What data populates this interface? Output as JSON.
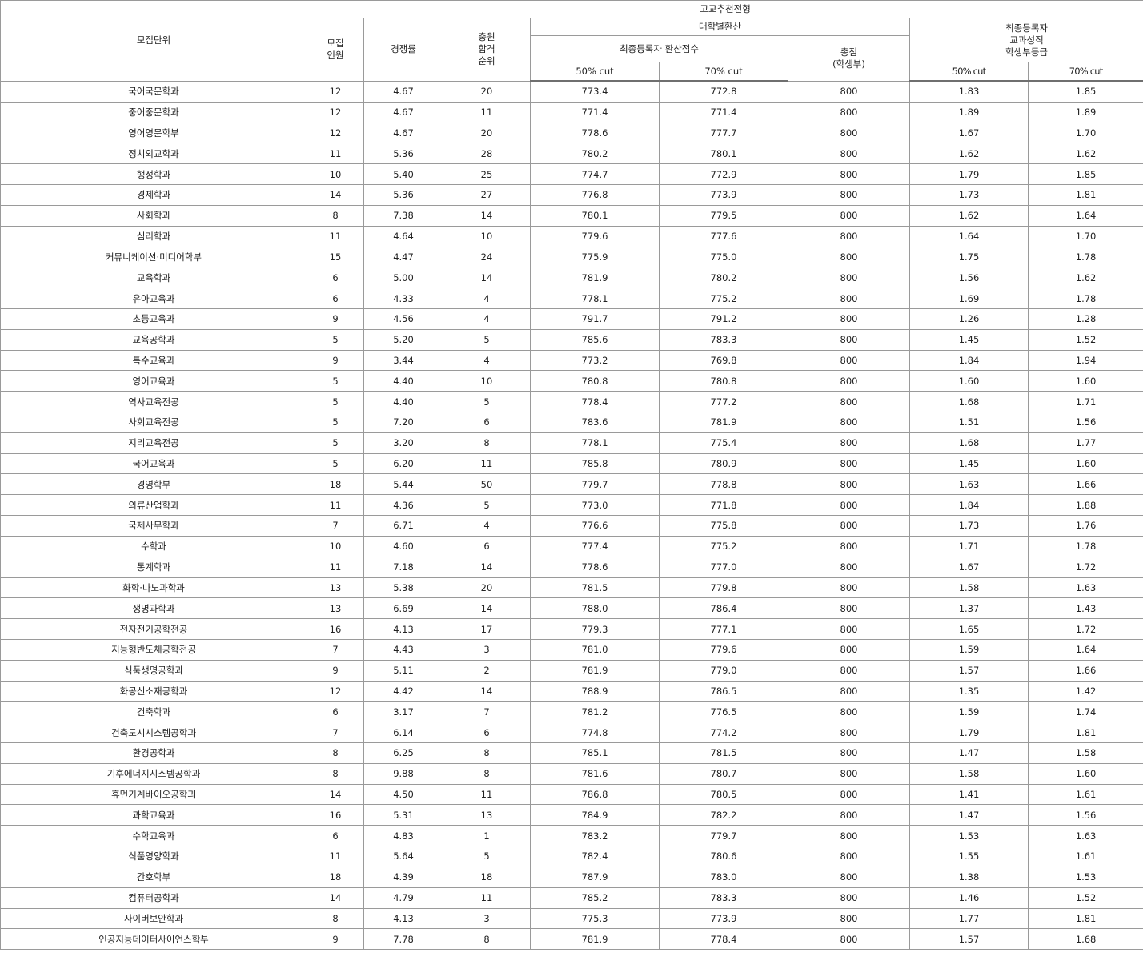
{
  "header": {
    "unit": "모집단위",
    "track": "고교추천전형",
    "quota": [
      "모집",
      "인원"
    ],
    "competition": "경쟁률",
    "waitlist": [
      "충원",
      "합격",
      "순위"
    ],
    "univ_conversion": "대학별환산",
    "final_converted": "최종등록자 환산점수",
    "cut50": "50% cut",
    "cut70": "70% cut",
    "total": [
      "총점",
      "(학생부)"
    ],
    "final_grade": [
      "최종등록자",
      "교과성적",
      "학생부등급"
    ],
    "grade50": "50% cut",
    "grade70": "70% cut"
  },
  "rows": [
    {
      "unit": "국어국문학과",
      "quota": "12",
      "rate": "4.67",
      "wait": "20",
      "s50": "773.4",
      "s70": "772.8",
      "total": "800",
      "g50": "1.83",
      "g70": "1.85"
    },
    {
      "unit": "중어중문학과",
      "quota": "12",
      "rate": "4.67",
      "wait": "11",
      "s50": "771.4",
      "s70": "771.4",
      "total": "800",
      "g50": "1.89",
      "g70": "1.89"
    },
    {
      "unit": "영어영문학부",
      "quota": "12",
      "rate": "4.67",
      "wait": "20",
      "s50": "778.6",
      "s70": "777.7",
      "total": "800",
      "g50": "1.67",
      "g70": "1.70"
    },
    {
      "unit": "정치외교학과",
      "quota": "11",
      "rate": "5.36",
      "wait": "28",
      "s50": "780.2",
      "s70": "780.1",
      "total": "800",
      "g50": "1.62",
      "g70": "1.62"
    },
    {
      "unit": "행정학과",
      "quota": "10",
      "rate": "5.40",
      "wait": "25",
      "s50": "774.7",
      "s70": "772.9",
      "total": "800",
      "g50": "1.79",
      "g70": "1.85"
    },
    {
      "unit": "경제학과",
      "quota": "14",
      "rate": "5.36",
      "wait": "27",
      "s50": "776.8",
      "s70": "773.9",
      "total": "800",
      "g50": "1.73",
      "g70": "1.81"
    },
    {
      "unit": "사회학과",
      "quota": "8",
      "rate": "7.38",
      "wait": "14",
      "s50": "780.1",
      "s70": "779.5",
      "total": "800",
      "g50": "1.62",
      "g70": "1.64"
    },
    {
      "unit": "심리학과",
      "quota": "11",
      "rate": "4.64",
      "wait": "10",
      "s50": "779.6",
      "s70": "777.6",
      "total": "800",
      "g50": "1.64",
      "g70": "1.70"
    },
    {
      "unit": "커뮤니케이션·미디어학부",
      "quota": "15",
      "rate": "4.47",
      "wait": "24",
      "s50": "775.9",
      "s70": "775.0",
      "total": "800",
      "g50": "1.75",
      "g70": "1.78"
    },
    {
      "unit": "교육학과",
      "quota": "6",
      "rate": "5.00",
      "wait": "14",
      "s50": "781.9",
      "s70": "780.2",
      "total": "800",
      "g50": "1.56",
      "g70": "1.62"
    },
    {
      "unit": "유아교육과",
      "quota": "6",
      "rate": "4.33",
      "wait": "4",
      "s50": "778.1",
      "s70": "775.2",
      "total": "800",
      "g50": "1.69",
      "g70": "1.78"
    },
    {
      "unit": "초등교육과",
      "quota": "9",
      "rate": "4.56",
      "wait": "4",
      "s50": "791.7",
      "s70": "791.2",
      "total": "800",
      "g50": "1.26",
      "g70": "1.28"
    },
    {
      "unit": "교육공학과",
      "quota": "5",
      "rate": "5.20",
      "wait": "5",
      "s50": "785.6",
      "s70": "783.3",
      "total": "800",
      "g50": "1.45",
      "g70": "1.52"
    },
    {
      "unit": "특수교육과",
      "quota": "9",
      "rate": "3.44",
      "wait": "4",
      "s50": "773.2",
      "s70": "769.8",
      "total": "800",
      "g50": "1.84",
      "g70": "1.94"
    },
    {
      "unit": "영어교육과",
      "quota": "5",
      "rate": "4.40",
      "wait": "10",
      "s50": "780.8",
      "s70": "780.8",
      "total": "800",
      "g50": "1.60",
      "g70": "1.60"
    },
    {
      "unit": "역사교육전공",
      "quota": "5",
      "rate": "4.40",
      "wait": "5",
      "s50": "778.4",
      "s70": "777.2",
      "total": "800",
      "g50": "1.68",
      "g70": "1.71"
    },
    {
      "unit": "사회교육전공",
      "quota": "5",
      "rate": "7.20",
      "wait": "6",
      "s50": "783.6",
      "s70": "781.9",
      "total": "800",
      "g50": "1.51",
      "g70": "1.56"
    },
    {
      "unit": "지리교육전공",
      "quota": "5",
      "rate": "3.20",
      "wait": "8",
      "s50": "778.1",
      "s70": "775.4",
      "total": "800",
      "g50": "1.68",
      "g70": "1.77"
    },
    {
      "unit": "국어교육과",
      "quota": "5",
      "rate": "6.20",
      "wait": "11",
      "s50": "785.8",
      "s70": "780.9",
      "total": "800",
      "g50": "1.45",
      "g70": "1.60"
    },
    {
      "unit": "경영학부",
      "quota": "18",
      "rate": "5.44",
      "wait": "50",
      "s50": "779.7",
      "s70": "778.8",
      "total": "800",
      "g50": "1.63",
      "g70": "1.66"
    },
    {
      "unit": "의류산업학과",
      "quota": "11",
      "rate": "4.36",
      "wait": "5",
      "s50": "773.0",
      "s70": "771.8",
      "total": "800",
      "g50": "1.84",
      "g70": "1.88"
    },
    {
      "unit": "국제사무학과",
      "quota": "7",
      "rate": "6.71",
      "wait": "4",
      "s50": "776.6",
      "s70": "775.8",
      "total": "800",
      "g50": "1.73",
      "g70": "1.76"
    },
    {
      "unit": "수학과",
      "quota": "10",
      "rate": "4.60",
      "wait": "6",
      "s50": "777.4",
      "s70": "775.2",
      "total": "800",
      "g50": "1.71",
      "g70": "1.78"
    },
    {
      "unit": "통계학과",
      "quota": "11",
      "rate": "7.18",
      "wait": "14",
      "s50": "778.6",
      "s70": "777.0",
      "total": "800",
      "g50": "1.67",
      "g70": "1.72"
    },
    {
      "unit": "화학·나노과학과",
      "quota": "13",
      "rate": "5.38",
      "wait": "20",
      "s50": "781.5",
      "s70": "779.8",
      "total": "800",
      "g50": "1.58",
      "g70": "1.63"
    },
    {
      "unit": "생명과학과",
      "quota": "13",
      "rate": "6.69",
      "wait": "14",
      "s50": "788.0",
      "s70": "786.4",
      "total": "800",
      "g50": "1.37",
      "g70": "1.43"
    },
    {
      "unit": "전자전기공학전공",
      "quota": "16",
      "rate": "4.13",
      "wait": "17",
      "s50": "779.3",
      "s70": "777.1",
      "total": "800",
      "g50": "1.65",
      "g70": "1.72"
    },
    {
      "unit": "지능형반도체공학전공",
      "quota": "7",
      "rate": "4.43",
      "wait": "3",
      "s50": "781.0",
      "s70": "779.6",
      "total": "800",
      "g50": "1.59",
      "g70": "1.64"
    },
    {
      "unit": "식품생명공학과",
      "quota": "9",
      "rate": "5.11",
      "wait": "2",
      "s50": "781.9",
      "s70": "779.0",
      "total": "800",
      "g50": "1.57",
      "g70": "1.66"
    },
    {
      "unit": "화공신소재공학과",
      "quota": "12",
      "rate": "4.42",
      "wait": "14",
      "s50": "788.9",
      "s70": "786.5",
      "total": "800",
      "g50": "1.35",
      "g70": "1.42"
    },
    {
      "unit": "건축학과",
      "quota": "6",
      "rate": "3.17",
      "wait": "7",
      "s50": "781.2",
      "s70": "776.5",
      "total": "800",
      "g50": "1.59",
      "g70": "1.74"
    },
    {
      "unit": "건축도시시스템공학과",
      "quota": "7",
      "rate": "6.14",
      "wait": "6",
      "s50": "774.8",
      "s70": "774.2",
      "total": "800",
      "g50": "1.79",
      "g70": "1.81"
    },
    {
      "unit": "환경공학과",
      "quota": "8",
      "rate": "6.25",
      "wait": "8",
      "s50": "785.1",
      "s70": "781.5",
      "total": "800",
      "g50": "1.47",
      "g70": "1.58"
    },
    {
      "unit": "기후에너지시스템공학과",
      "quota": "8",
      "rate": "9.88",
      "wait": "8",
      "s50": "781.6",
      "s70": "780.7",
      "total": "800",
      "g50": "1.58",
      "g70": "1.60"
    },
    {
      "unit": "휴먼기계바이오공학과",
      "quota": "14",
      "rate": "4.50",
      "wait": "11",
      "s50": "786.8",
      "s70": "780.5",
      "total": "800",
      "g50": "1.41",
      "g70": "1.61"
    },
    {
      "unit": "과학교육과",
      "quota": "16",
      "rate": "5.31",
      "wait": "13",
      "s50": "784.9",
      "s70": "782.2",
      "total": "800",
      "g50": "1.47",
      "g70": "1.56"
    },
    {
      "unit": "수학교육과",
      "quota": "6",
      "rate": "4.83",
      "wait": "1",
      "s50": "783.2",
      "s70": "779.7",
      "total": "800",
      "g50": "1.53",
      "g70": "1.63"
    },
    {
      "unit": "식품영양학과",
      "quota": "11",
      "rate": "5.64",
      "wait": "5",
      "s50": "782.4",
      "s70": "780.6",
      "total": "800",
      "g50": "1.55",
      "g70": "1.61"
    },
    {
      "unit": "간호학부",
      "quota": "18",
      "rate": "4.39",
      "wait": "18",
      "s50": "787.9",
      "s70": "783.0",
      "total": "800",
      "g50": "1.38",
      "g70": "1.53"
    },
    {
      "unit": "컴퓨터공학과",
      "quota": "14",
      "rate": "4.79",
      "wait": "11",
      "s50": "785.2",
      "s70": "783.3",
      "total": "800",
      "g50": "1.46",
      "g70": "1.52"
    },
    {
      "unit": "사이버보안학과",
      "quota": "8",
      "rate": "4.13",
      "wait": "3",
      "s50": "775.3",
      "s70": "773.9",
      "total": "800",
      "g50": "1.77",
      "g70": "1.81"
    },
    {
      "unit": "인공지능데이터사이언스학부",
      "quota": "9",
      "rate": "7.78",
      "wait": "8",
      "s50": "781.9",
      "s70": "778.4",
      "total": "800",
      "g50": "1.57",
      "g70": "1.68"
    }
  ]
}
